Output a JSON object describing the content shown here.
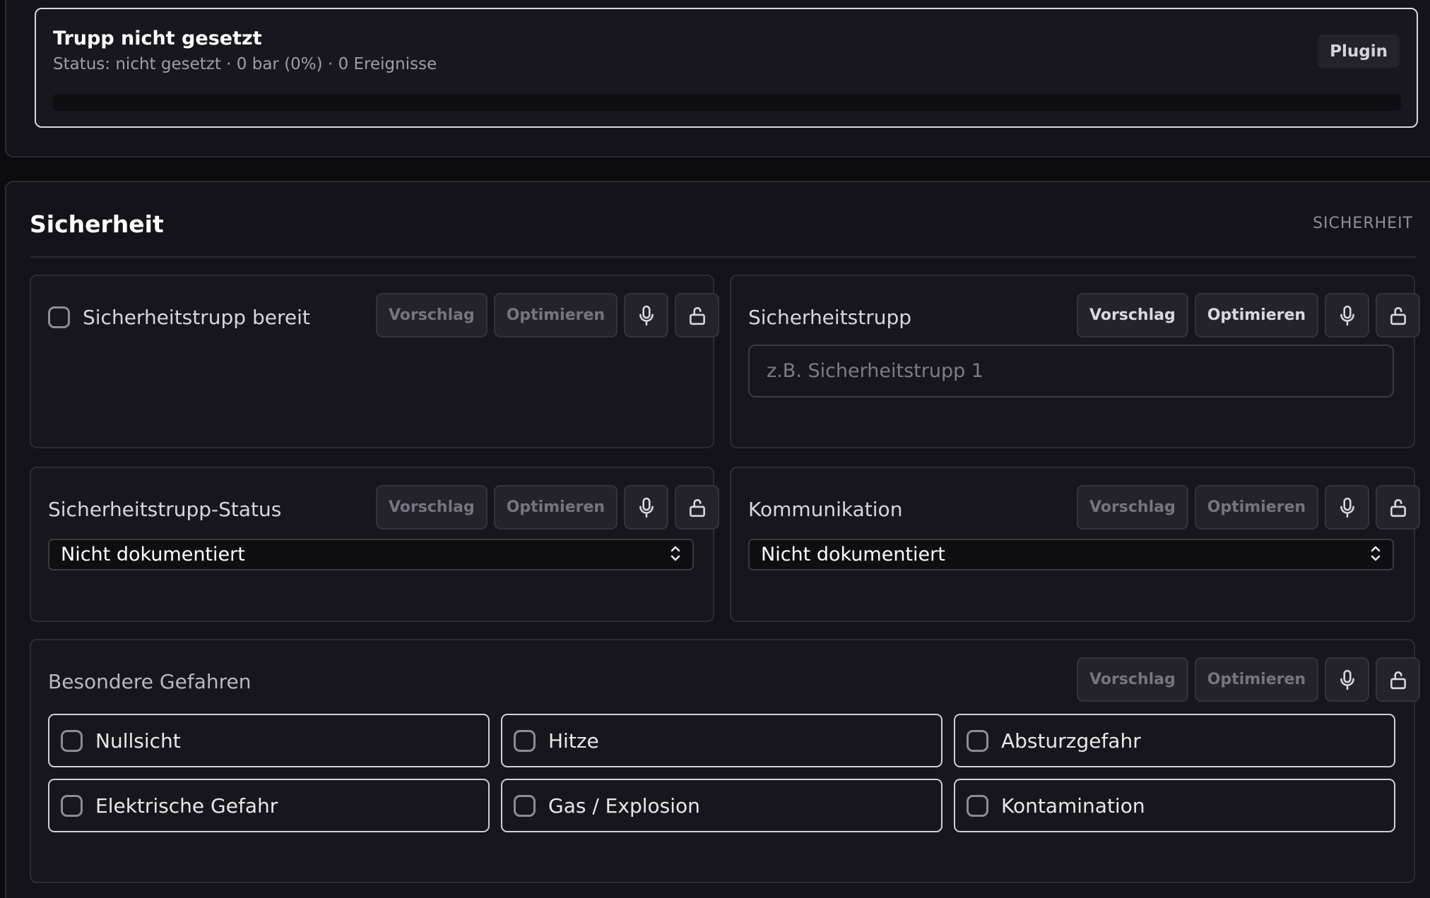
{
  "trupp": {
    "title": "Trupp nicht gesetzt",
    "status": "Status: nicht gesetzt · 0 bar (0%) · 0 Ereignisse",
    "badge": "Plugin",
    "progress_percent": 0
  },
  "section": {
    "title": "Sicherheit",
    "tag": "SICHERHEIT"
  },
  "tools": {
    "suggest": "Vorschlag",
    "optimize": "Optimieren",
    "mic_icon": "microphone-icon",
    "lock_icon": "unlock-icon"
  },
  "fields": {
    "ready": {
      "label": "Sicherheitstrupp bereit",
      "checked": false
    },
    "trupp": {
      "label": "Sicherheitstrupp",
      "placeholder": "z.B. Sicherheitstrupp 1",
      "value": ""
    },
    "status": {
      "label": "Sicherheitstrupp-Status",
      "value": "Nicht dokumentiert"
    },
    "comm": {
      "label": "Kommunikation",
      "value": "Nicht dokumentiert"
    },
    "hazards": {
      "label": "Besondere Gefahren",
      "options": [
        {
          "label": "Nullsicht",
          "checked": false
        },
        {
          "label": "Hitze",
          "checked": false
        },
        {
          "label": "Absturzgefahr",
          "checked": false
        },
        {
          "label": "Elektrische Gefahr",
          "checked": false
        },
        {
          "label": "Gas / Explosion",
          "checked": false
        },
        {
          "label": "Kontamination",
          "checked": false
        }
      ]
    }
  }
}
